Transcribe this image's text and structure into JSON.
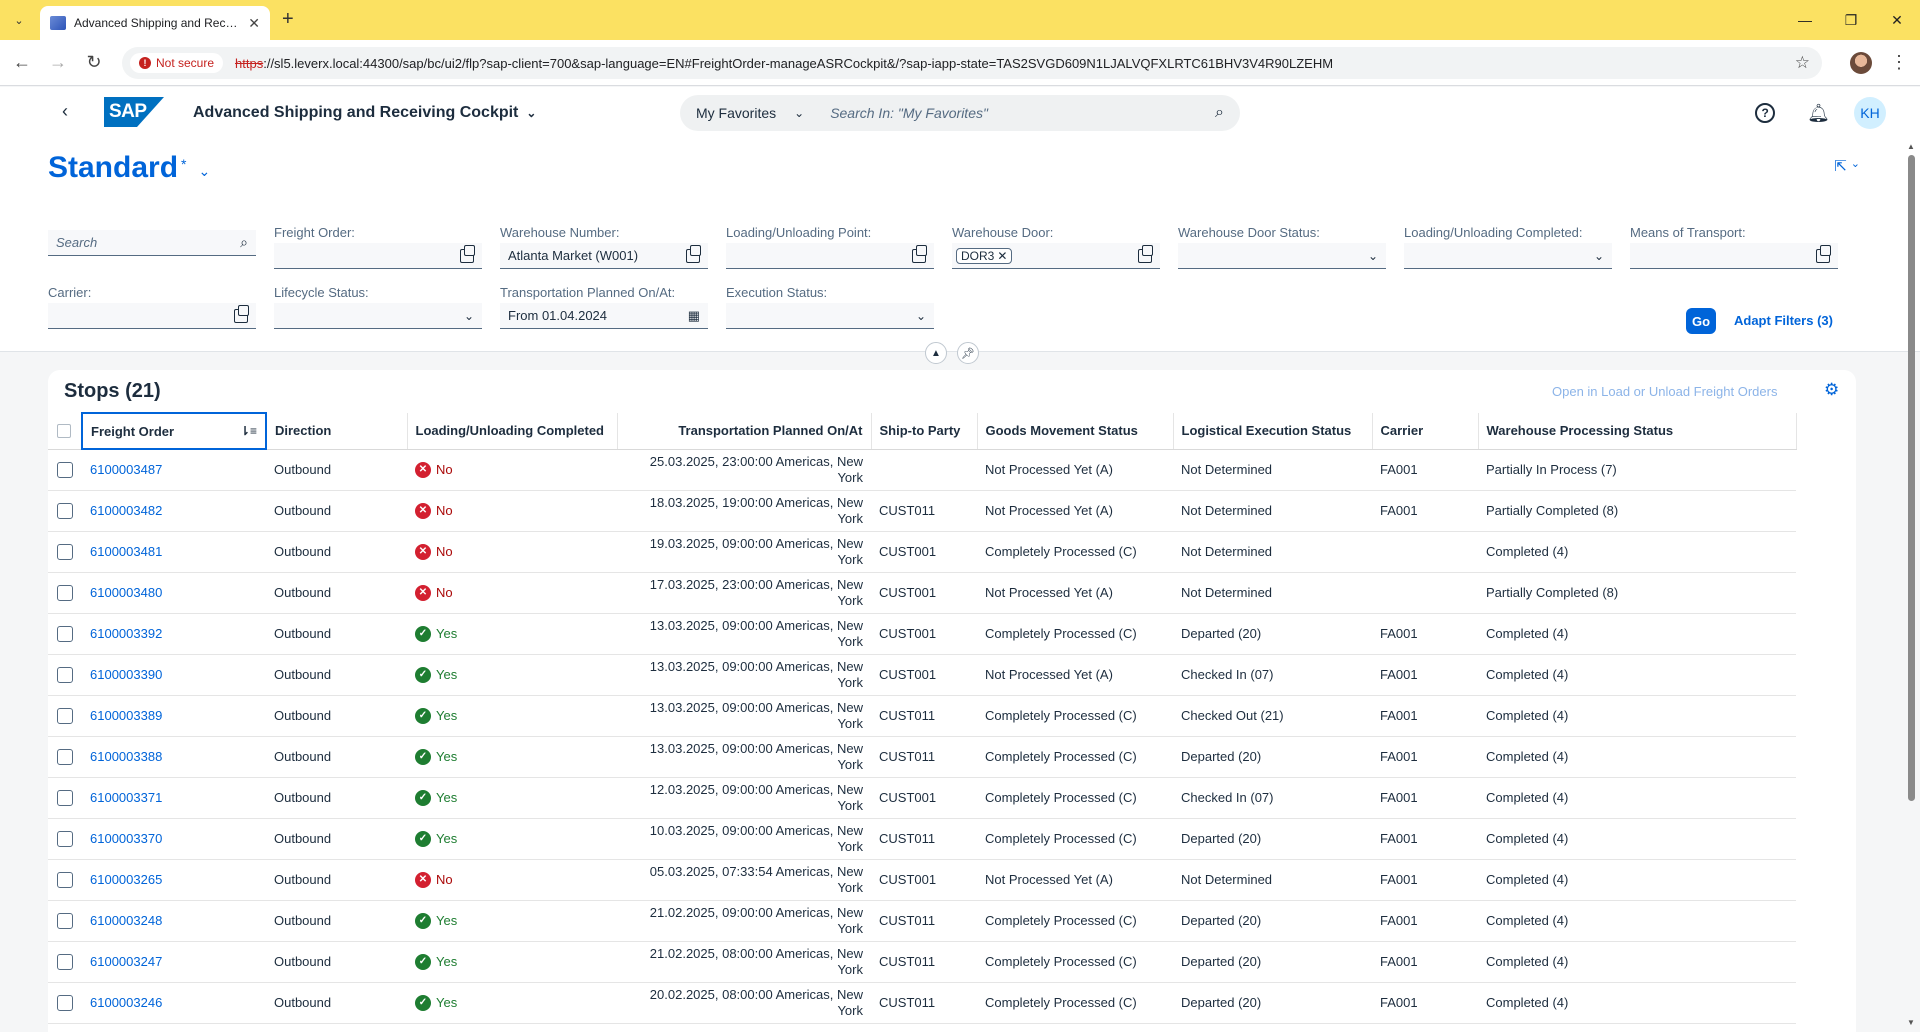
{
  "browser": {
    "tab_title": "Advanced Shipping and Receiving Cockpit",
    "security_label": "Not secure",
    "url_proto": "https",
    "url_rest": "://sl5.leverx.local:44300/sap/bc/ui2/flp?sap-client=700&sap-language=EN#FreightOrder-manageASRCockpit&/?sap-iapp-state=TAS2SVGD609N1LJALVQFXLRTC61BHV3V4R90LZEHM"
  },
  "shell": {
    "app_title": "Advanced Shipping and Receiving Cockpit",
    "search_scope": "My Favorites",
    "search_placeholder": "Search In: \"My Favorites\"",
    "avatar_initials": "KH",
    "help_icon": "?",
    "brand_color": "#0064d9"
  },
  "header": {
    "variant_name": "Standard",
    "variant_modified": "*"
  },
  "filters": {
    "search_placeholder": "Search",
    "freight_order_label": "Freight Order:",
    "warehouse_number_label": "Warehouse Number:",
    "warehouse_number_value": "Atlanta Market (W001)",
    "loading_point_label": "Loading/Unloading Point:",
    "warehouse_door_label": "Warehouse Door:",
    "warehouse_door_token": "DOR3",
    "warehouse_door_status_label": "Warehouse Door Status:",
    "loading_completed_label": "Loading/Unloading Completed:",
    "means_of_transport_label": "Means of Transport:",
    "carrier_label": "Carrier:",
    "lifecycle_status_label": "Lifecycle Status:",
    "transport_planned_label": "Transportation Planned On/At:",
    "transport_planned_value": "From 01.04.2024",
    "execution_status_label": "Execution Status:",
    "go_label": "Go",
    "adapt_filters_label": "Adapt Filters (3)"
  },
  "table": {
    "title": "Stops (21)",
    "open_link": "Open in Load or Unload Freight Orders",
    "columns": {
      "freight_order": "Freight Order",
      "direction": "Direction",
      "loading_completed": "Loading/Unloading Completed",
      "transport_planned": "Transportation Planned On/At",
      "ship_to": "Ship-to Party",
      "goods_movement": "Goods Movement Status",
      "logistical_execution": "Logistical Execution Status",
      "carrier": "Carrier",
      "warehouse_processing": "Warehouse Processing Status"
    },
    "rows": [
      {
        "fo": "6100003487",
        "dir": "Outbound",
        "done": "No",
        "done_ok": false,
        "tp1": "25.03.2025, 23:00:00 Americas, New",
        "tp2": "York",
        "ship": "",
        "gm": "Not Processed Yet (A)",
        "le": "Not Determined",
        "car": "FA001",
        "wp": "Partially In Process (7)"
      },
      {
        "fo": "6100003482",
        "dir": "Outbound",
        "done": "No",
        "done_ok": false,
        "tp1": "18.03.2025, 19:00:00 Americas, New",
        "tp2": "York",
        "ship": "CUST011",
        "gm": "Not Processed Yet (A)",
        "le": "Not Determined",
        "car": "FA001",
        "wp": "Partially Completed (8)"
      },
      {
        "fo": "6100003481",
        "dir": "Outbound",
        "done": "No",
        "done_ok": false,
        "tp1": "19.03.2025, 09:00:00 Americas, New",
        "tp2": "York",
        "ship": "CUST001",
        "gm": "Completely Processed (C)",
        "le": "Not Determined",
        "car": "",
        "wp": "Completed (4)"
      },
      {
        "fo": "6100003480",
        "dir": "Outbound",
        "done": "No",
        "done_ok": false,
        "tp1": "17.03.2025, 23:00:00 Americas, New",
        "tp2": "York",
        "ship": "CUST001",
        "gm": "Not Processed Yet (A)",
        "le": "Not Determined",
        "car": "",
        "wp": "Partially Completed (8)"
      },
      {
        "fo": "6100003392",
        "dir": "Outbound",
        "done": "Yes",
        "done_ok": true,
        "tp1": "13.03.2025, 09:00:00 Americas, New",
        "tp2": "York",
        "ship": "CUST001",
        "gm": "Completely Processed (C)",
        "le": "Departed (20)",
        "car": "FA001",
        "wp": "Completed (4)"
      },
      {
        "fo": "6100003390",
        "dir": "Outbound",
        "done": "Yes",
        "done_ok": true,
        "tp1": "13.03.2025, 09:00:00 Americas, New",
        "tp2": "York",
        "ship": "CUST001",
        "gm": "Not Processed Yet (A)",
        "le": "Checked In (07)",
        "car": "FA001",
        "wp": "Completed (4)"
      },
      {
        "fo": "6100003389",
        "dir": "Outbound",
        "done": "Yes",
        "done_ok": true,
        "tp1": "13.03.2025, 09:00:00 Americas, New",
        "tp2": "York",
        "ship": "CUST011",
        "gm": "Completely Processed (C)",
        "le": "Checked Out (21)",
        "car": "FA001",
        "wp": "Completed (4)"
      },
      {
        "fo": "6100003388",
        "dir": "Outbound",
        "done": "Yes",
        "done_ok": true,
        "tp1": "13.03.2025, 09:00:00 Americas, New",
        "tp2": "York",
        "ship": "CUST011",
        "gm": "Completely Processed (C)",
        "le": "Departed (20)",
        "car": "FA001",
        "wp": "Completed (4)"
      },
      {
        "fo": "6100003371",
        "dir": "Outbound",
        "done": "Yes",
        "done_ok": true,
        "tp1": "12.03.2025, 09:00:00 Americas, New",
        "tp2": "York",
        "ship": "CUST001",
        "gm": "Completely Processed (C)",
        "le": "Checked In (07)",
        "car": "FA001",
        "wp": "Completed (4)"
      },
      {
        "fo": "6100003370",
        "dir": "Outbound",
        "done": "Yes",
        "done_ok": true,
        "tp1": "10.03.2025, 09:00:00 Americas, New",
        "tp2": "York",
        "ship": "CUST011",
        "gm": "Completely Processed (C)",
        "le": "Departed (20)",
        "car": "FA001",
        "wp": "Completed (4)"
      },
      {
        "fo": "6100003265",
        "dir": "Outbound",
        "done": "No",
        "done_ok": false,
        "tp1": "05.03.2025, 07:33:54 Americas, New",
        "tp2": "York",
        "ship": "CUST001",
        "gm": "Not Processed Yet (A)",
        "le": "Not Determined",
        "car": "FA001",
        "wp": "Completed (4)"
      },
      {
        "fo": "6100003248",
        "dir": "Outbound",
        "done": "Yes",
        "done_ok": true,
        "tp1": "21.02.2025, 09:00:00 Americas, New",
        "tp2": "York",
        "ship": "CUST011",
        "gm": "Completely Processed (C)",
        "le": "Departed (20)",
        "car": "FA001",
        "wp": "Completed (4)"
      },
      {
        "fo": "6100003247",
        "dir": "Outbound",
        "done": "Yes",
        "done_ok": true,
        "tp1": "21.02.2025, 08:00:00 Americas, New",
        "tp2": "York",
        "ship": "CUST011",
        "gm": "Completely Processed (C)",
        "le": "Departed (20)",
        "car": "FA001",
        "wp": "Completed (4)"
      },
      {
        "fo": "6100003246",
        "dir": "Outbound",
        "done": "Yes",
        "done_ok": true,
        "tp1": "20.02.2025, 08:00:00 Americas, New",
        "tp2": "York",
        "ship": "CUST011",
        "gm": "Completely Processed (C)",
        "le": "Departed (20)",
        "car": "FA001",
        "wp": "Completed (4)"
      }
    ]
  }
}
